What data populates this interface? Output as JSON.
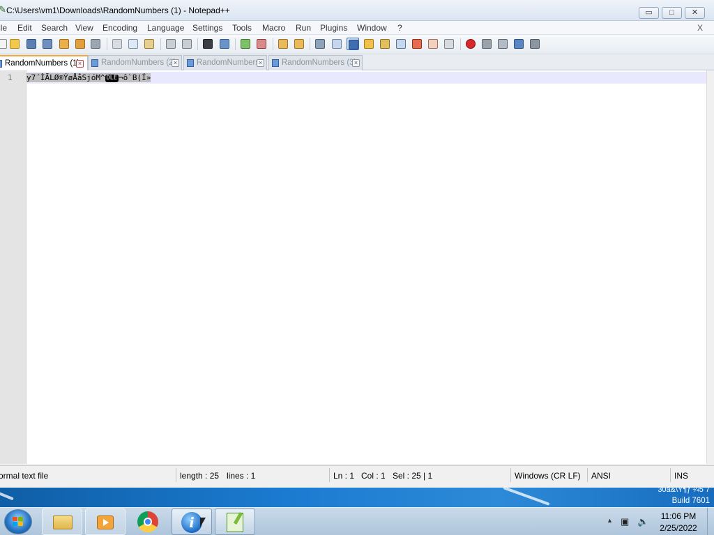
{
  "window": {
    "title": "C:\\Users\\vm1\\Downloads\\RandomNumbers (1) - Notepad++",
    "min_glyph": "▭",
    "max_glyph": "□",
    "close_glyph": "✕"
  },
  "menu": {
    "items": [
      "ile",
      "Edit",
      "Search",
      "View",
      "Encoding",
      "Language",
      "Settings",
      "Tools",
      "Macro",
      "Run",
      "Plugins",
      "Window",
      "?"
    ],
    "close_label": "X"
  },
  "toolbar": {
    "icons": [
      "new-file",
      "open-file",
      "save",
      "save-all",
      "close",
      "close-all",
      "print",
      "cut",
      "copy",
      "paste",
      "undo",
      "redo",
      "find",
      "replace",
      "zoom-in",
      "zoom-out",
      "sync-vertical",
      "sync-horizontal",
      "word-wrap",
      "show-all-characters",
      "indent-guide",
      "user-defined-language",
      "document-map",
      "function-list",
      "folder-as-workspace",
      "document-list",
      "monitoring",
      "record-macro",
      "stop-recording",
      "play-macro",
      "run-macro-multiple",
      "save-macro"
    ]
  },
  "tabs": [
    {
      "label": "RandomNumbers (1)",
      "active": true
    },
    {
      "label": "RandomNumbers (2)",
      "active": false
    },
    {
      "label": "RandomNumbers",
      "active": false
    },
    {
      "label": "RandomNumbers (3)",
      "active": false
    }
  ],
  "editor": {
    "line_numbers": [
      "1"
    ],
    "content_before": "y7´ÌÃLØ®ÝøÅåSjóM^",
    "control_char": "DLE",
    "content_after": "¬ô`B(Í»"
  },
  "status": {
    "file_type": "ormal text file",
    "length": "length : 25",
    "lines": "lines : 1",
    "ln": "Ln : 1",
    "col": "Col : 1",
    "sel": "Sel : 25 | 1",
    "eol": "Windows (CR LF)",
    "encoding": "ANSI",
    "mode": "INS"
  },
  "desktop": {
    "watermark_line1": "30a&\\Ÿ¶ƒ'¼5 7",
    "watermark_line2": "Build 7601"
  },
  "taskbar": {
    "apps": [
      "file-explorer",
      "media-player",
      "chrome",
      "internet-explorer",
      "notepad-plus-plus"
    ],
    "time": "11:06 PM",
    "date": "2/25/2022"
  },
  "colors": {
    "active_tab_accent": "#f4a640",
    "selection": "#c0c0c0",
    "current_line": "#e8e8ff",
    "desktop_blue": "#1b7bd0"
  }
}
